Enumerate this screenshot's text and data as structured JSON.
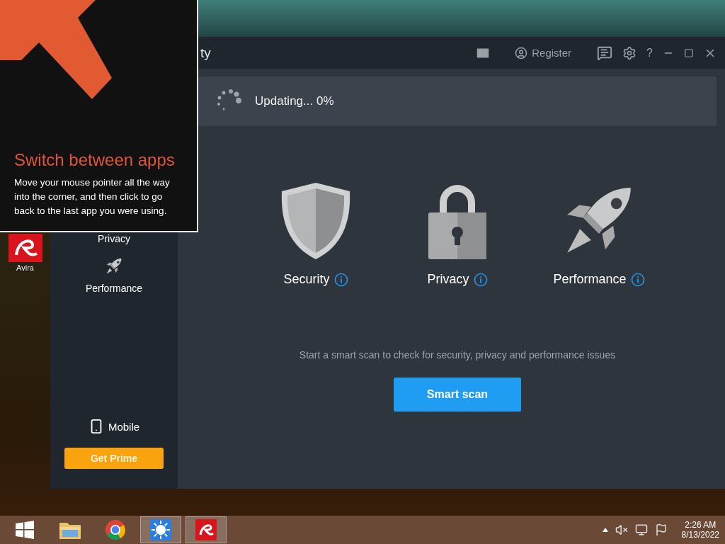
{
  "overlay": {
    "title": "Switch between apps",
    "body": "Move your mouse pointer all the way into the corner, and then click to go back to the last app you were using."
  },
  "desktop_icons": [
    {
      "label": "Avira"
    }
  ],
  "window": {
    "title": "ty",
    "register": "Register",
    "help": "?"
  },
  "sidebar": {
    "items": [
      {
        "label": "Privacy",
        "kind": "plain"
      },
      {
        "label": "Performance",
        "kind": "rocket"
      }
    ],
    "mobile": "Mobile",
    "prime_button": "Get Prime"
  },
  "status": {
    "text": "Updating... 0%"
  },
  "categories": [
    {
      "label": "Security",
      "kind": "shield"
    },
    {
      "label": "Privacy",
      "kind": "lock"
    },
    {
      "label": "Performance",
      "kind": "rocket"
    }
  ],
  "hint": "Start a smart scan to check for security, privacy and performance issues",
  "scan_button": "Smart scan",
  "taskbar": {
    "apps": [
      {
        "kind": "explorer",
        "running": false
      },
      {
        "kind": "chrome",
        "running": false
      },
      {
        "kind": "weather",
        "running": true
      },
      {
        "kind": "avira",
        "running": true
      }
    ],
    "time": "2:26 AM",
    "date": "8/13/2022"
  }
}
